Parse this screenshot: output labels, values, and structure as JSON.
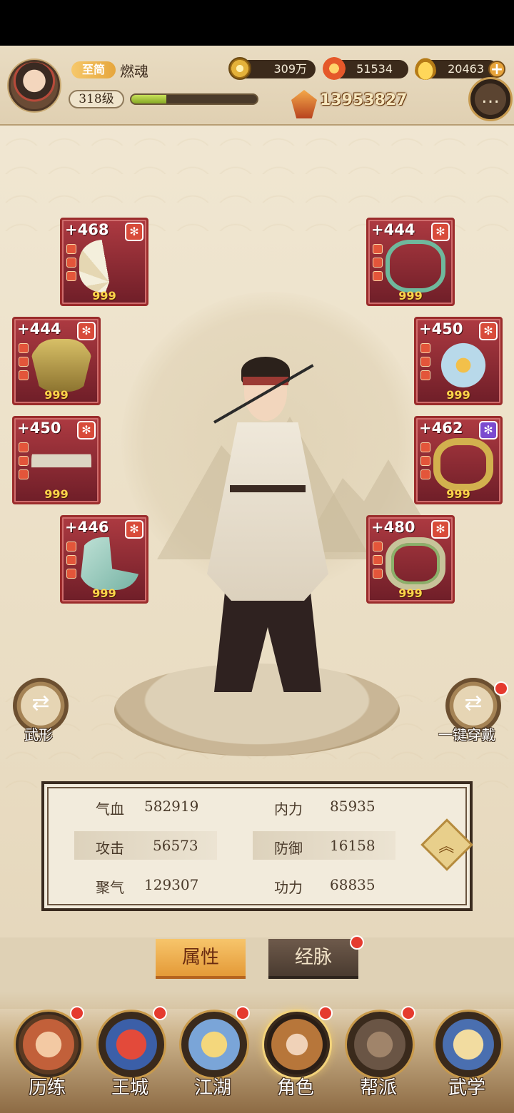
{
  "player": {
    "rank_badge": "至简",
    "name": "燃魂",
    "level": "318级",
    "exp_fraction": 0.28,
    "power": "13953827"
  },
  "resources": [
    {
      "icon": "copper-coin-icon",
      "value": "309万"
    },
    {
      "icon": "flame-crystal-icon",
      "value": "51534"
    },
    {
      "icon": "gold-ingot-icon",
      "value": "20463"
    }
  ],
  "equipment": [
    {
      "id": "fan",
      "plus": "+468",
      "count": "999",
      "icon": "fan-weapon-icon",
      "gem": "red"
    },
    {
      "id": "necklace",
      "plus": "+444",
      "count": "999",
      "icon": "necklace-icon",
      "gem": "red"
    },
    {
      "id": "armor",
      "plus": "+444",
      "count": "999",
      "icon": "armor-icon",
      "gem": "red"
    },
    {
      "id": "hairpin",
      "plus": "+450",
      "count": "999",
      "icon": "flower-hairpin-icon",
      "gem": "red"
    },
    {
      "id": "belt",
      "plus": "+450",
      "count": "999",
      "icon": "belt-icon",
      "gem": "red"
    },
    {
      "id": "bracer",
      "plus": "+462",
      "count": "999",
      "icon": "bracer-icon",
      "gem": "purple"
    },
    {
      "id": "boots",
      "plus": "+446",
      "count": "999",
      "icon": "boots-icon",
      "gem": "red"
    },
    {
      "id": "ring",
      "plus": "+480",
      "count": "999",
      "icon": "ring-icon",
      "gem": "red"
    }
  ],
  "side_buttons": {
    "left_label": "武形",
    "right_label": "一键穿戴"
  },
  "stats": [
    {
      "left_label": "气血",
      "left_value": "582919",
      "right_label": "内力",
      "right_value": "85935"
    },
    {
      "left_label": "攻击",
      "left_value": "56573",
      "right_label": "防御",
      "right_value": "16158"
    },
    {
      "left_label": "聚气",
      "left_value": "129307",
      "right_label": "功力",
      "right_value": "68835"
    }
  ],
  "subtabs": {
    "active": "属性",
    "inactive": "经脉"
  },
  "nav": [
    {
      "label": "历练",
      "icon": "training-scroll-icon",
      "badge": true
    },
    {
      "label": "王城",
      "icon": "palace-gate-icon",
      "badge": true
    },
    {
      "label": "江湖",
      "icon": "sword-lion-icon",
      "badge": true
    },
    {
      "label": "角色",
      "icon": "hero-hat-icon",
      "badge": true
    },
    {
      "label": "帮派",
      "icon": "guild-seal-icon",
      "badge": true
    },
    {
      "label": "武学",
      "icon": "martial-scroll-icon",
      "badge": false
    }
  ],
  "colors": {
    "accent_gold": "#e6a33a",
    "slot_red": "#ad3a41",
    "exp_green": "#86a925",
    "badge_red": "#e53a2e"
  }
}
